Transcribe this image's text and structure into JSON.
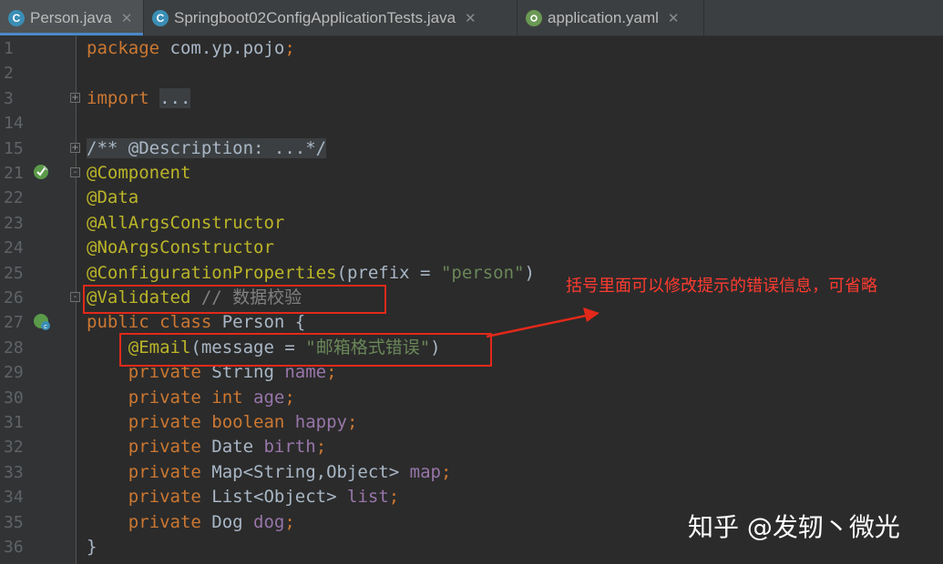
{
  "tabs": [
    {
      "label": "Person.java",
      "icon": "class-c-icon",
      "icon_color": "#3b8eb5",
      "active": true
    },
    {
      "label": "Springboot02ConfigApplicationTests.java",
      "icon": "test-class-icon",
      "icon_color": "#3b8eb5",
      "active": false
    },
    {
      "label": "application.yaml",
      "icon": "spring-leaf-icon",
      "icon_color": "#6a9955",
      "active": false
    }
  ],
  "code_lines": [
    {
      "number": "1",
      "parts": [
        [
          "kw",
          "package "
        ],
        [
          "",
          "com.yp.pojo"
        ],
        [
          "kw",
          ";"
        ]
      ]
    },
    {
      "number": "2",
      "parts": []
    },
    {
      "number": "3",
      "fold": "+",
      "parts": [
        [
          "kw",
          "import "
        ],
        [
          "fold-bg",
          "..."
        ]
      ]
    },
    {
      "number": "14",
      "parts": []
    },
    {
      "number": "15",
      "fold": "+",
      "parts": [
        [
          "fold-bg cmt",
          "/** @Description: ...*/"
        ]
      ]
    },
    {
      "number": "21",
      "fold": "-",
      "gutter_icon": "bean-check",
      "parts": [
        [
          "ann",
          "@Component"
        ]
      ]
    },
    {
      "number": "22",
      "parts": [
        [
          "ann",
          "@Data"
        ]
      ]
    },
    {
      "number": "23",
      "parts": [
        [
          "ann",
          "@AllArgsConstructor"
        ]
      ]
    },
    {
      "number": "24",
      "parts": [
        [
          "ann",
          "@NoArgsConstructor"
        ]
      ]
    },
    {
      "number": "25",
      "parts": [
        [
          "ann",
          "@ConfigurationProperties"
        ],
        [
          "",
          "(prefix = "
        ],
        [
          "str",
          "\"person\""
        ],
        [
          "",
          ")"
        ]
      ]
    },
    {
      "number": "26",
      "fold": "-",
      "parts": [
        [
          "ann",
          "@Validated"
        ],
        [
          "cmt",
          " // 数据校验"
        ]
      ]
    },
    {
      "number": "27",
      "gutter_icon": "bean-class",
      "parts": [
        [
          "kw",
          "public class "
        ],
        [
          "",
          "Person {"
        ]
      ]
    },
    {
      "number": "28",
      "parts": [
        [
          "",
          "    "
        ],
        [
          "ann",
          "@Email"
        ],
        [
          "",
          "(message = "
        ],
        [
          "str",
          "\"邮箱格式错误\""
        ],
        [
          "",
          ")"
        ]
      ]
    },
    {
      "number": "29",
      "parts": [
        [
          "",
          "    "
        ],
        [
          "kw",
          "private "
        ],
        [
          "",
          "String "
        ],
        [
          "fld",
          "name"
        ],
        [
          "kw",
          ";"
        ]
      ]
    },
    {
      "number": "30",
      "parts": [
        [
          "",
          "    "
        ],
        [
          "kw",
          "private int "
        ],
        [
          "fld",
          "age"
        ],
        [
          "kw",
          ";"
        ]
      ]
    },
    {
      "number": "31",
      "parts": [
        [
          "",
          "    "
        ],
        [
          "kw",
          "private boolean "
        ],
        [
          "fld",
          "happy"
        ],
        [
          "kw",
          ";"
        ]
      ]
    },
    {
      "number": "32",
      "parts": [
        [
          "",
          "    "
        ],
        [
          "kw",
          "private "
        ],
        [
          "",
          "Date "
        ],
        [
          "fld",
          "birth"
        ],
        [
          "kw",
          ";"
        ]
      ]
    },
    {
      "number": "33",
      "parts": [
        [
          "",
          "    "
        ],
        [
          "kw",
          "private "
        ],
        [
          "",
          "Map<String,Object> "
        ],
        [
          "fld",
          "map"
        ],
        [
          "kw",
          ";"
        ]
      ]
    },
    {
      "number": "34",
      "parts": [
        [
          "",
          "    "
        ],
        [
          "kw",
          "private "
        ],
        [
          "",
          "List<Object> "
        ],
        [
          "fld",
          "list"
        ],
        [
          "kw",
          ";"
        ]
      ]
    },
    {
      "number": "35",
      "parts": [
        [
          "",
          "    "
        ],
        [
          "kw",
          "private "
        ],
        [
          "",
          "Dog "
        ],
        [
          "fld",
          "dog"
        ],
        [
          "kw",
          ";"
        ]
      ]
    },
    {
      "number": "36",
      "parts": [
        [
          "",
          "}"
        ]
      ]
    }
  ],
  "annotation": {
    "text": "括号里面可以修改提示的错误信息，可省略",
    "color": "#ff3b30"
  },
  "watermark": "知乎 @发轫丶微光",
  "colors": {
    "editor_bg": "#2b2b2b",
    "keyword": "#cc7832",
    "annotation": "#bbb529",
    "string": "#6a8759",
    "field": "#9876aa",
    "highlight_box": "#e2291a"
  }
}
